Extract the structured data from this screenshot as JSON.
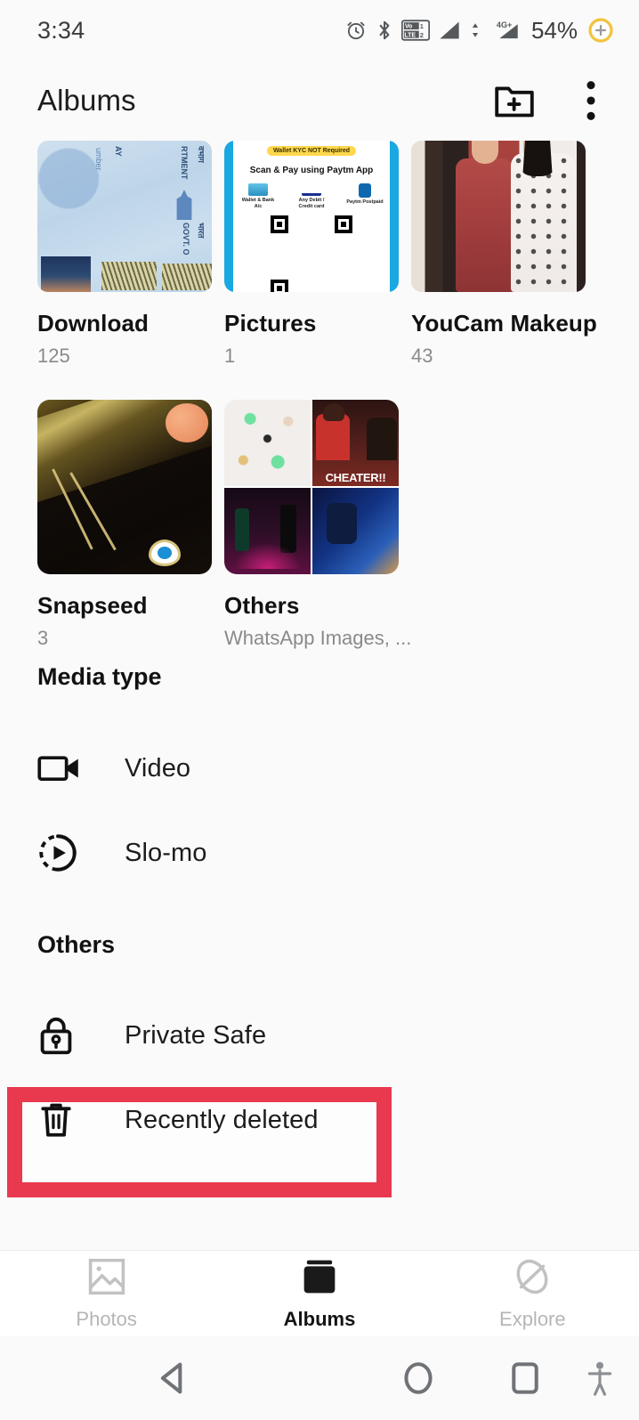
{
  "status_bar": {
    "time": "3:34",
    "battery_percent": "54%",
    "network_label": "4G+",
    "volte_label": "VoLTE",
    "sim_labels": [
      "1",
      "2"
    ],
    "icons": [
      "alarm-icon",
      "bluetooth-icon",
      "volte-icon",
      "signal-bars-icon",
      "signal-bars-icon",
      "battery-charging-icon"
    ]
  },
  "app_bar": {
    "title": "Albums",
    "create_folder_label": "Create album",
    "overflow_label": "More options"
  },
  "albums": {
    "row1": [
      {
        "name": "Download",
        "count": "125",
        "thumb": "pan-card-thumbnail"
      },
      {
        "name": "Pictures",
        "count": "1",
        "thumb": "paytm-qr-thumbnail"
      },
      {
        "name": "YouCam Makeup",
        "count": "43",
        "thumb": "couple-photo-thumbnail"
      }
    ],
    "row2": [
      {
        "name": "Snapseed",
        "count": "3",
        "thumb": "necklace-photo-thumbnail"
      },
      {
        "name": "Others",
        "count": "WhatsApp Images, ...",
        "thumb": "collage-thumbnail"
      }
    ],
    "qr_thumb": {
      "badge": "Wallet KYC NOT Required",
      "heading": "Scan & Pay using Paytm App",
      "options": [
        "Wallet & Bank A/c",
        "Any Debit / Credit card",
        "Paytm Postpaid"
      ]
    },
    "collage_thumb": {
      "caption": "CHEATER!!"
    }
  },
  "media_type": {
    "heading": "Media type",
    "items": [
      {
        "label": "Video",
        "icon": "video-camera-icon"
      },
      {
        "label": "Slo-mo",
        "icon": "slow-motion-icon"
      }
    ]
  },
  "others": {
    "heading": "Others",
    "items": [
      {
        "label": "Private Safe",
        "icon": "lock-icon"
      },
      {
        "label": "Recently deleted",
        "icon": "trash-icon"
      }
    ]
  },
  "highlight": {
    "target": "Recently deleted",
    "color": "#e8394f"
  },
  "bottom_nav": {
    "tabs": [
      {
        "label": "Photos",
        "icon": "photo-icon",
        "active": false
      },
      {
        "label": "Albums",
        "icon": "albums-icon",
        "active": true
      },
      {
        "label": "Explore",
        "icon": "explore-icon",
        "active": false
      }
    ]
  },
  "system_nav": {
    "buttons": [
      "back-button",
      "home-button",
      "recents-button",
      "accessibility-button"
    ]
  },
  "colors": {
    "background": "#fafafa",
    "accent_highlight": "#e8394f",
    "text_primary": "#1c1c1c",
    "text_secondary": "#8a8a8a",
    "nav_inactive": "#b6b6b6"
  }
}
